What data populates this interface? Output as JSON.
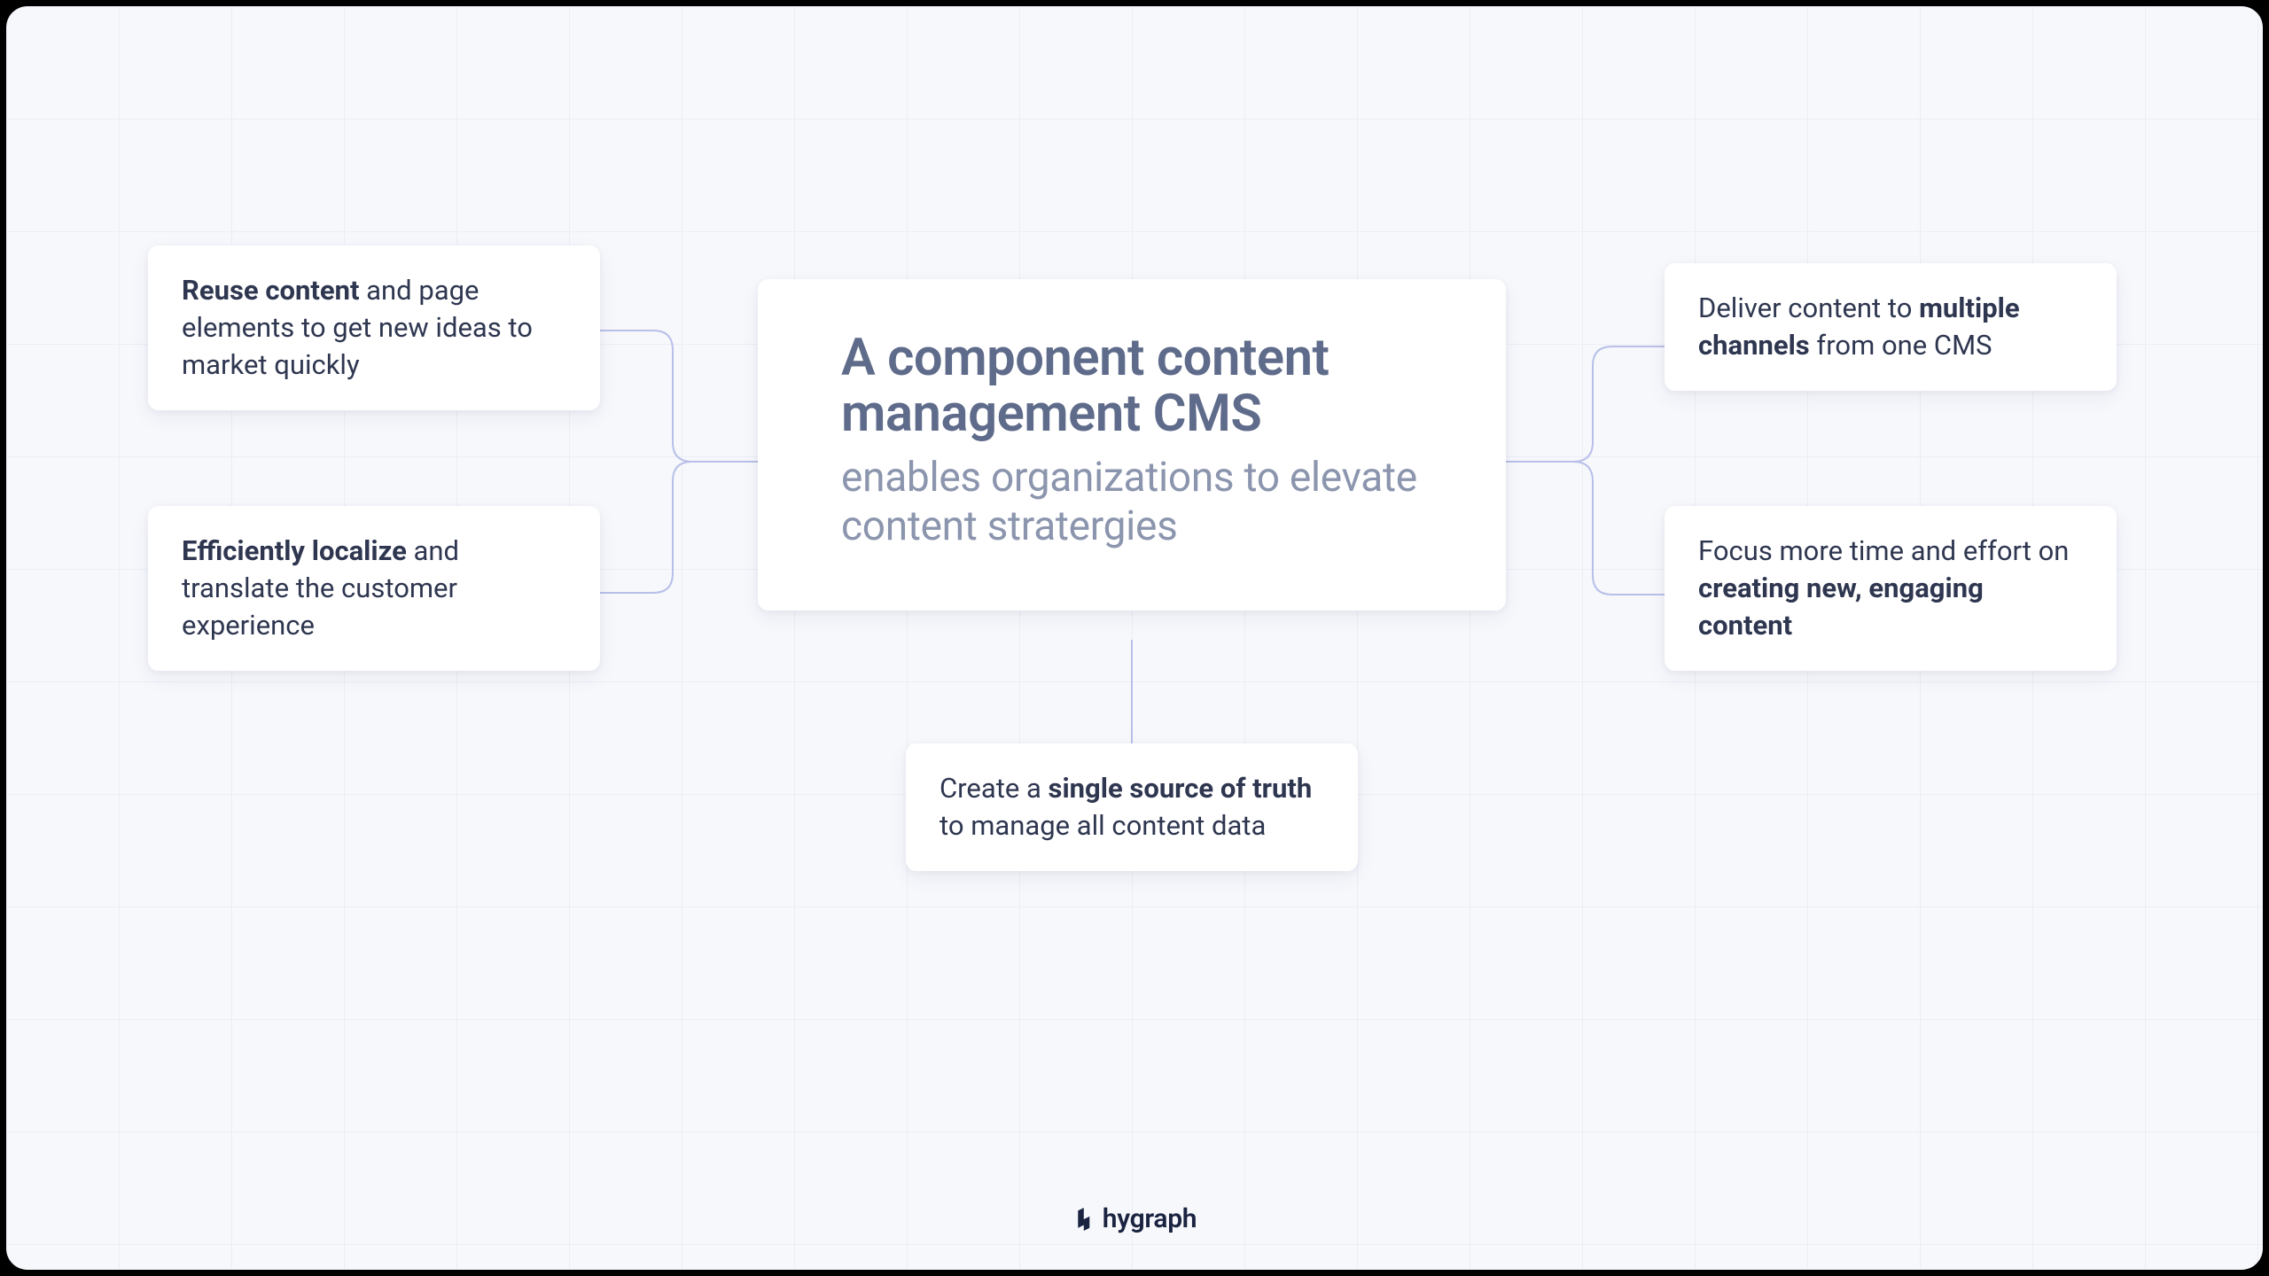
{
  "center": {
    "title": "A component content management CMS",
    "subtitle": "enables organizations to elevate content stratergies"
  },
  "nodes": {
    "lt": {
      "bold": "Reuse content",
      "rest": " and page elements to get new ideas to market quickly"
    },
    "lb": {
      "bold": "Efficiently localize",
      "rest": " and translate the customer experience"
    },
    "rt": {
      "pre": "Deliver content to ",
      "bold": "multiple channels",
      "rest": " from one CMS"
    },
    "rb": {
      "pre": "Focus more time and effort on ",
      "bold": "creating new, engaging content",
      "rest": ""
    },
    "bt": {
      "pre": "Create a ",
      "bold": "single source of truth",
      "rest": " to manage all content data"
    }
  },
  "brand": "hygraph"
}
